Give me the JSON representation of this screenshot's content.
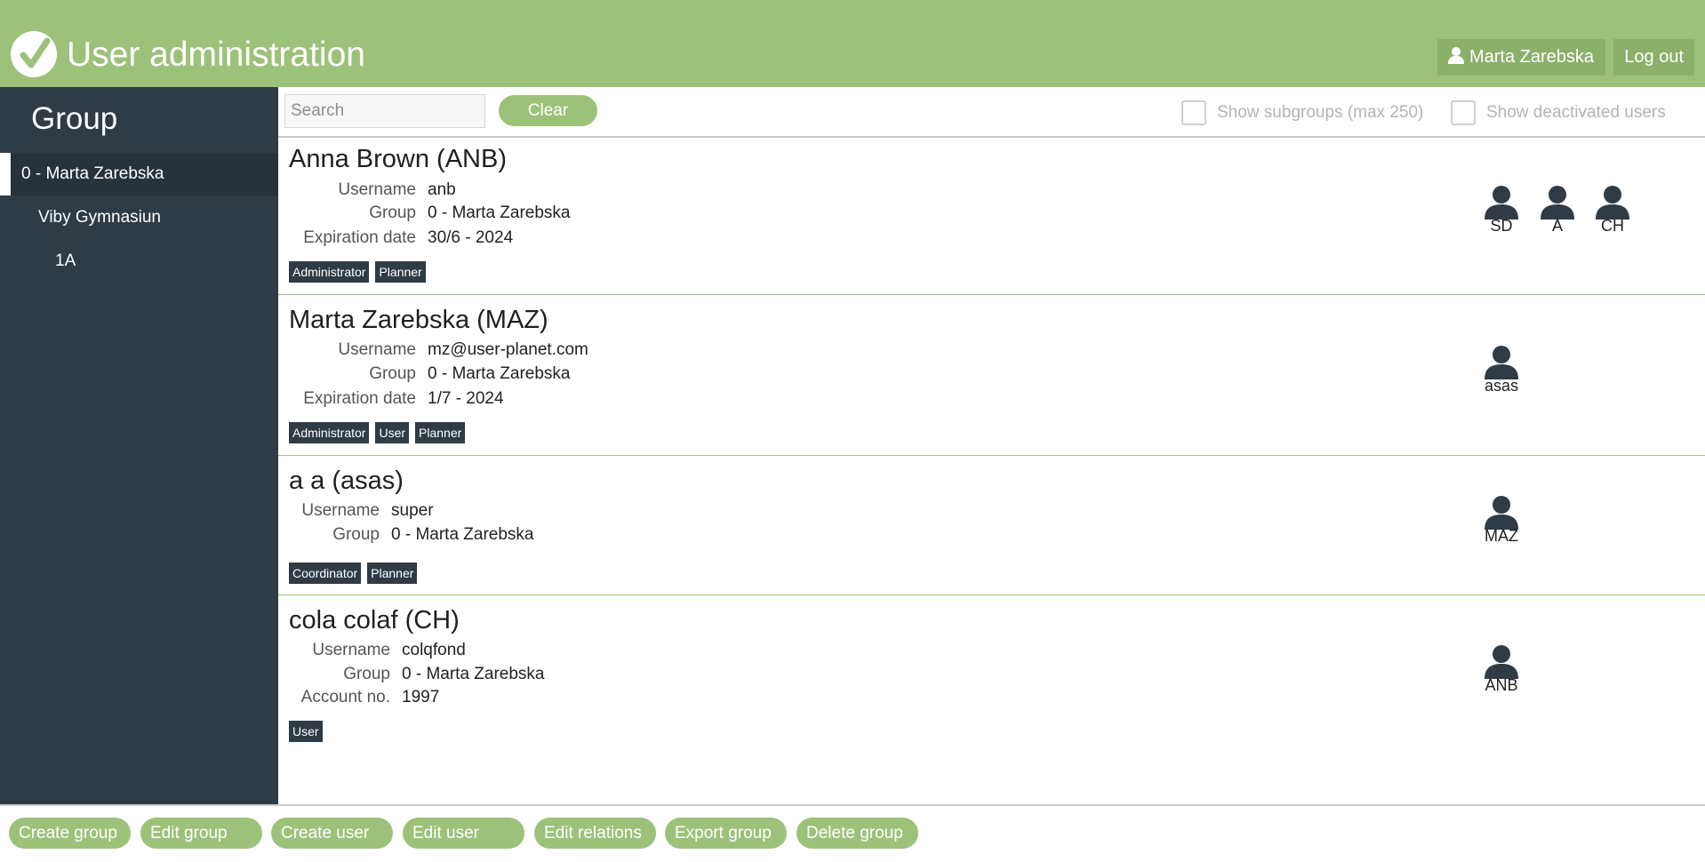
{
  "app": {
    "title": "User administration",
    "logo_icon": "check-circle-icon"
  },
  "header": {
    "user_name": "Marta Zarebska",
    "user_icon": "user-icon",
    "logout_label": "Log out"
  },
  "sidebar": {
    "title": "Group",
    "items": [
      {
        "label": "0 - Marta Zarebska",
        "selected": true
      },
      {
        "label": "Viby Gymnasiun"
      },
      {
        "label": "1A"
      }
    ]
  },
  "toolbar": {
    "search_placeholder": "Search",
    "clear_label": "Clear",
    "show_subgroups_label": "Show subgroups (max 250)",
    "show_deactivated_label": "Show deactivated users"
  },
  "users": [
    {
      "name": "Anna Brown  (ANB)",
      "fields": [
        {
          "key": "Username",
          "value": "anb"
        },
        {
          "key": "Group",
          "value": "0 - Marta Zarebska"
        },
        {
          "key": "Expiration date",
          "value": "30/6 - 2024"
        }
      ],
      "tags": [
        "Administrator",
        "Planner"
      ],
      "relations": [
        "SD",
        "A",
        "CH"
      ]
    },
    {
      "name": "Marta Zarebska  (MAZ)",
      "fields": [
        {
          "key": "Username",
          "value": "mz@user-planet.com"
        },
        {
          "key": "Group",
          "value": "0 - Marta Zarebska"
        },
        {
          "key": "Expiration date",
          "value": "1/7 - 2024"
        }
      ],
      "tags": [
        "Administrator",
        "User",
        "Planner"
      ],
      "relations": [
        "asas"
      ]
    },
    {
      "name": "a a  (asas)",
      "fields": [
        {
          "key": "Username",
          "value": "super"
        },
        {
          "key": "Group",
          "value": "0 - Marta Zarebska"
        }
      ],
      "tags": [
        "Coordinator",
        "Planner"
      ],
      "relations": [
        "MAZ"
      ]
    },
    {
      "name": "cola colaf  (CH)",
      "fields": [
        {
          "key": "Username",
          "value": "colqfond"
        },
        {
          "key": "Group",
          "value": "0 - Marta Zarebska"
        },
        {
          "key": "Account no.",
          "value": "1997"
        }
      ],
      "tags": [
        "User"
      ],
      "relations": [
        "ANB"
      ]
    }
  ],
  "bottom_buttons": [
    "Create group",
    "Edit group",
    "Create user",
    "Edit user",
    "Edit relations",
    "Export group",
    "Delete group"
  ],
  "colors": {
    "brand_green": "#9cc27a",
    "sidebar_dark": "#2f3b45",
    "tag_dark": "#2f3b45"
  }
}
